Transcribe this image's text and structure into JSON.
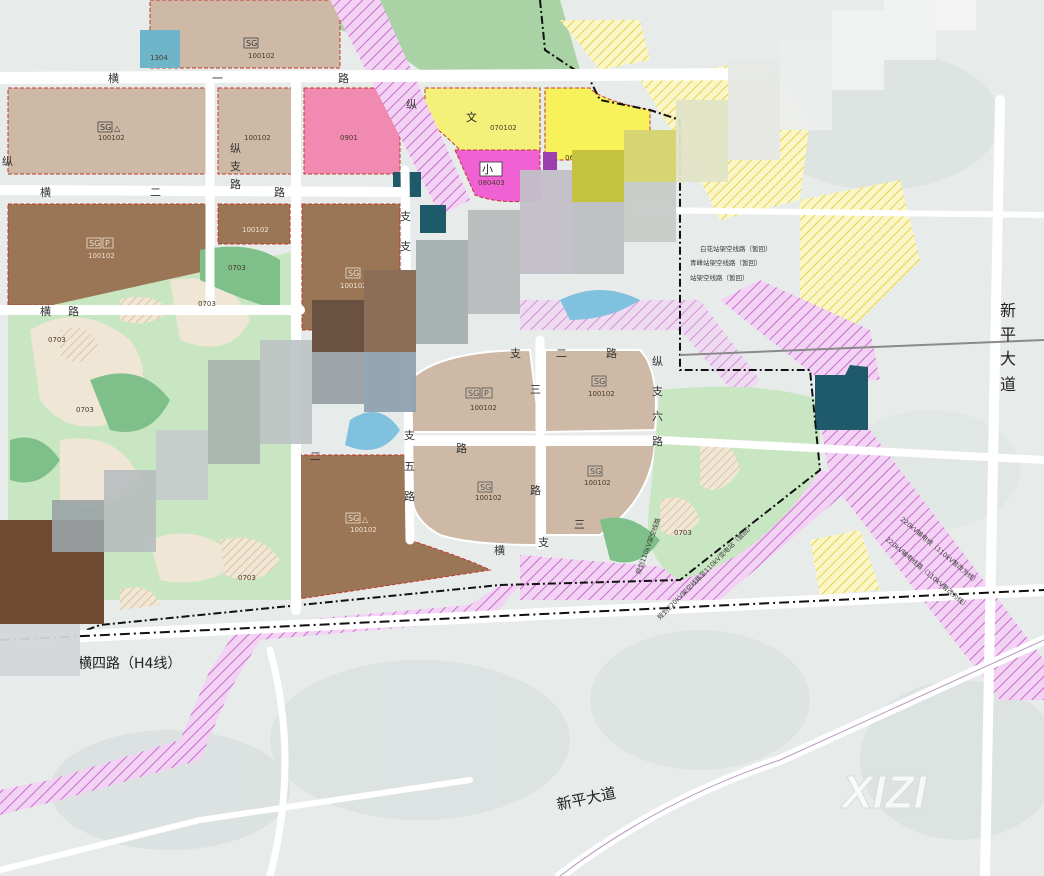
{
  "map": {
    "road_labels": {
      "heng_yi_a": "横",
      "heng_yi_b": "一",
      "heng_yi_c": "路",
      "heng_er_a": "横",
      "heng_er_b": "二",
      "heng_er_c": "路",
      "heng_san_a": "横",
      "heng_san_b": "路",
      "zong_a": "纵",
      "zong_b": "支",
      "zong_c": "路",
      "zong_d": "纵",
      "zong_e": "支",
      "zong_f": "纵",
      "zong_g": "支",
      "zhi_er": "支",
      "zhi_er_b": "二",
      "zhi_er_c": "路",
      "zhi_san": "三",
      "zhi_san_b": "路",
      "zhi_wu_a": "支",
      "zhi_wu_b": "五",
      "zhi_wu_c": "路",
      "zong_liu_a": "纵",
      "zong_liu_b": "支",
      "zong_liu_c": "六",
      "zong_liu_d": "路",
      "heng_zhi_a": "横",
      "heng_zhi_b": "支",
      "heng_zhi_c": "三",
      "heng_si": "横四路（H4线）",
      "xinping_south": "新平大道",
      "xinping_east": [
        "新",
        "平",
        "大",
        "道"
      ]
    },
    "parcel_codes": {
      "top_center": "100102",
      "top_left": "1304",
      "row1_left": "100102",
      "row1_mid": "100102",
      "row1_pink": "0901",
      "row1_yellow": "070102",
      "row1_magenta": "080403",
      "row1_small": "0602",
      "row2_left": "100102",
      "row2_mid": "100102",
      "row2_center": "100102",
      "green_a": "0703",
      "green_b": "0703",
      "green_c": "0703",
      "green_d": "0703",
      "east_a": "100102",
      "east_b": "100102",
      "east_c": "100102",
      "east_d": "100102",
      "south_parcel": "100102",
      "green_e": "0703",
      "green_f": "0703"
    },
    "badges": {
      "sg": "SG",
      "p": "P",
      "tri": "△",
      "xiao": "小",
      "wen": "文"
    },
    "power_lines": {
      "line_a": "白花站架空线路（暂回）",
      "line_b": "青峰站架空线路（暂回）",
      "line_c": "站架空线路（暂回）",
      "line_d": "220kV输电线（110kV暂改为线）",
      "line_e": "220kV输电线路（110kV暂改为线）",
      "line_f": "规划220kV架空线路至110kV变电站（暂回）",
      "line_g": "规划110kV架空线路",
      "line_h": "规划220kV中站架空线路"
    },
    "watermark": "XIZI"
  },
  "colors": {
    "residential": "#cdb9a6",
    "residential_dark": "#9a7556",
    "commercial": "#f08ab0",
    "education": "#f7f25a",
    "education_light": "#f5f07a",
    "green": "#7fc08a",
    "park_pale": "#c9e6c2",
    "utility": "#1f5a6b",
    "road": "#ffffff",
    "corridor": "#d98be0",
    "water": "#7fc1de",
    "ground": "#e8eded"
  }
}
